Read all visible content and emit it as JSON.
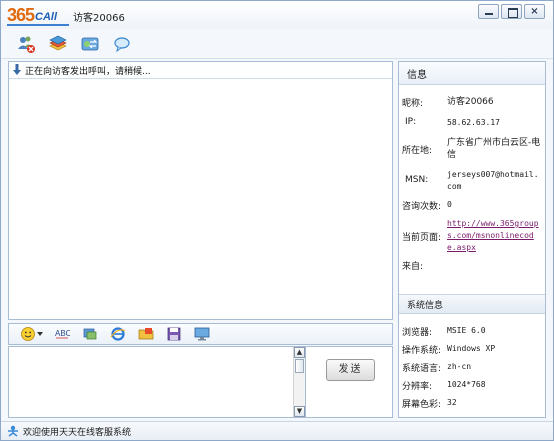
{
  "app": {
    "logo_number": "365",
    "logo_brand": "CAll",
    "title": "访客20066"
  },
  "window_controls": {
    "close_symbol": "×"
  },
  "toolbar": {
    "icons": [
      "block-user-icon",
      "book-icon",
      "transfer-icon",
      "chat-bubble-icon"
    ]
  },
  "chat": {
    "status_text": "正在向访客发出呼叫，请稍候..."
  },
  "input_toolbar": {
    "spell_label": "ABC"
  },
  "input": {
    "send_label": "发送"
  },
  "info": {
    "header": "信息",
    "rows": [
      {
        "label": "昵称:",
        "value": "访客20066"
      },
      {
        "label": "IP:",
        "value": "58.62.63.17"
      },
      {
        "label": "所在地:",
        "value": "广东省广州市白云区-电信"
      },
      {
        "label": "MSN:",
        "value": "jerseys007@hotmail.com"
      },
      {
        "label": "咨询次数:",
        "value": "0"
      },
      {
        "label": "当前页面:",
        "value": "http://www.365groups.com/msnonlinecode.aspx"
      },
      {
        "label": "来自:",
        "value": ""
      }
    ]
  },
  "system": {
    "header": "系统信息",
    "rows": [
      {
        "label": "浏览器:",
        "value": "MSIE 6.0"
      },
      {
        "label": "操作系统:",
        "value": "Windows XP"
      },
      {
        "label": "系统语言:",
        "value": "zh-cn"
      },
      {
        "label": "分辨率:",
        "value": "1024*768"
      },
      {
        "label": "屏幕色彩:",
        "value": "32"
      }
    ]
  },
  "statusbar": {
    "text": "欢迎使用天天在线客服系统"
  },
  "colors": {
    "logo_orange": "#e06a10",
    "logo_blue": "#1e5fb4",
    "border_blue": "#a8bcd4",
    "link_purple": "#7a1a6a"
  }
}
